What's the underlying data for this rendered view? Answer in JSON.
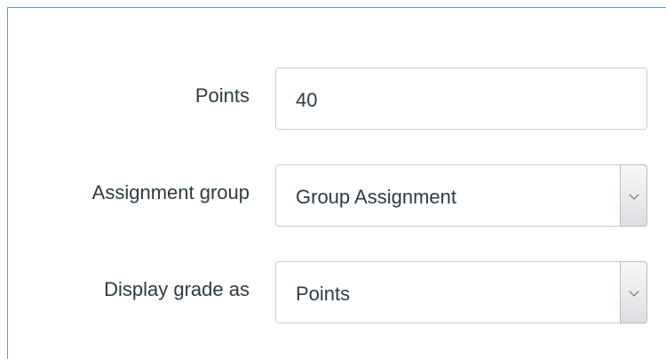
{
  "form": {
    "points": {
      "label": "Points",
      "value": "40"
    },
    "assignment_group": {
      "label": "Assignment group",
      "selected": "Group Assignment"
    },
    "display_grade_as": {
      "label": "Display grade as",
      "selected": "Points"
    }
  },
  "icons": {
    "dropdown": "chevron-down-icon"
  },
  "colors": {
    "frame_border": "#5b9bd5",
    "text": "#2d3b45",
    "field_border": "#c7cdd1"
  }
}
